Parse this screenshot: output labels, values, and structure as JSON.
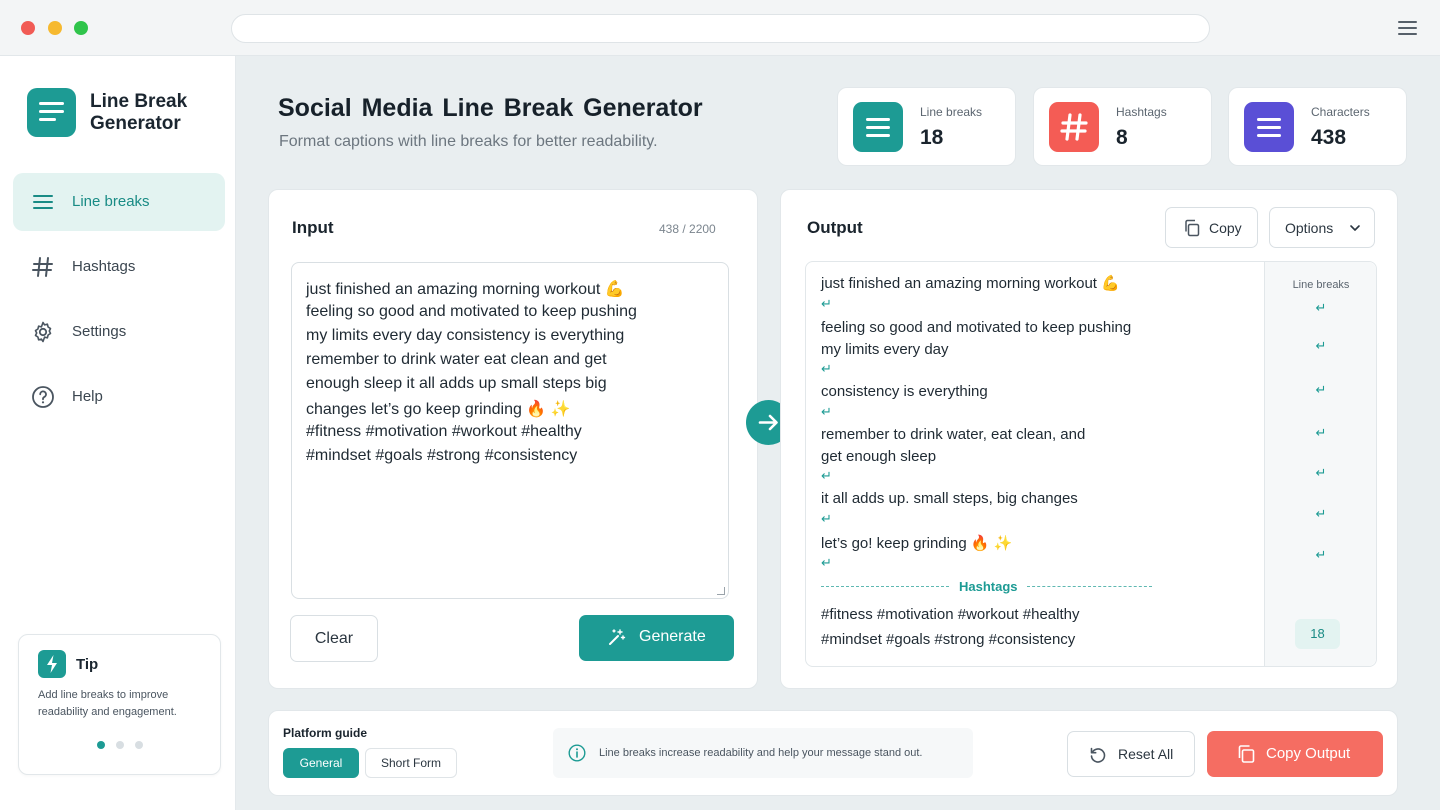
{
  "app": {
    "name": "Line Break Generator",
    "menu_icon": "hamburger-menu-icon"
  },
  "sidebar": {
    "items": [
      {
        "label": "Line breaks",
        "icon": "lines-icon",
        "active": true
      },
      {
        "label": "Hashtags",
        "icon": "hash-icon",
        "active": false
      },
      {
        "label": "Settings",
        "icon": "gear-icon",
        "active": false
      },
      {
        "label": "Help",
        "icon": "help-circle-icon",
        "active": false
      }
    ],
    "tip": {
      "title": "Tip",
      "text": "Add line breaks to improve readability and engagement."
    }
  },
  "header": {
    "title": "Social  Media  Line Break Generator",
    "subtitle": "Format captions with line breaks for better readability."
  },
  "stats": [
    {
      "label": "Line breaks",
      "value": "18",
      "color": "#1d9b94",
      "icon": "lines-icon"
    },
    {
      "label": "Hashtags",
      "value": "8",
      "color": "#f45c55",
      "icon": "hash-icon"
    },
    {
      "label": "Characters",
      "value": "438",
      "color": "#5a4fd6",
      "icon": "lines-icon"
    }
  ],
  "input": {
    "title": "Input",
    "count": "438 / 2200",
    "lines": [
      "just finished an amazing morning workout 💪",
      "feeling so good and motivated to keep pushing",
      "my limits every day consistency is everything",
      "remember to drink water eat clean and get",
      "enough sleep it all  adds up small steps big",
      "changes let’s go keep grinding 🔥 ✨",
      "#fitness #motivation #workout #healthy",
      "#mindset #goals #strong #consistency"
    ],
    "clear_label": "Clear",
    "generate_label": "Generate"
  },
  "output": {
    "title": "Output",
    "copy_label": "Copy",
    "options_label": "Options",
    "break_symbol": "↵",
    "lines": [
      "just finished an amazing morning workout 💪",
      "feeling so good and motivated to keep pushing",
      "my limits every day",
      "consistency is everything",
      "remember to drink water, eat clean, and",
      "get enough sleep",
      "it all adds up. small steps, big changes",
      "let’s go!  keep grinding 🔥 ✨"
    ],
    "hashtags_label": "Hashtags",
    "hashtag_lines": [
      "#fitness #motivation #workout #healthy",
      "#mindset #goals #strong #consistency"
    ],
    "line_breaks_title": "Line breaks",
    "line_breaks_count": "18"
  },
  "footer": {
    "platform_guide_title": "Platform guide",
    "platforms": [
      "General",
      "Short Form"
    ],
    "selected_platform": "General",
    "info_text": "Line breaks increase readability and help your message stand out.",
    "reset_label": "Reset All",
    "copy_output_label": "Copy Output"
  },
  "colors": {
    "accent": "#1d9b94",
    "danger": "#f56d62",
    "purple": "#5a4fd6"
  }
}
